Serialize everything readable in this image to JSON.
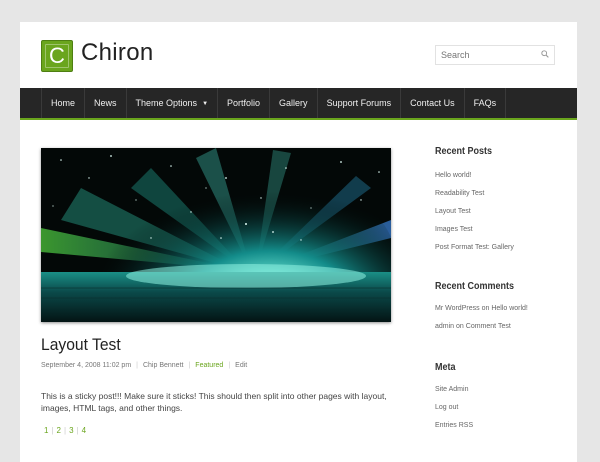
{
  "site": {
    "logo_letter": "C",
    "title": "Chiron",
    "accent_color": "#6aa51d"
  },
  "search": {
    "placeholder": "Search",
    "icon": "search-icon"
  },
  "nav": {
    "items": [
      {
        "label": "Home"
      },
      {
        "label": "News"
      },
      {
        "label": "Theme Options",
        "has_dropdown": true
      },
      {
        "label": "Portfolio"
      },
      {
        "label": "Gallery"
      },
      {
        "label": "Support Forums"
      },
      {
        "label": "Contact Us"
      },
      {
        "label": "FAQs"
      }
    ]
  },
  "post": {
    "image": "aurora-light-burst-over-water",
    "title": "Layout Test",
    "date": "September 4, 2008 11:02 pm",
    "author": "Chip Bennett",
    "category": "Featured",
    "edit_label": "Edit",
    "excerpt": "This is a sticky post!!! Make sure it sticks! This should then split into other pages with layout, images, HTML tags, and other things.",
    "pages": [
      "1",
      "2",
      "3",
      "4"
    ]
  },
  "sidebar": {
    "recent_posts": {
      "title": "Recent Posts",
      "items": [
        "Hello world!",
        "Readability Test",
        "Layout Test",
        "Images Test",
        "Post Format Test: Gallery"
      ]
    },
    "recent_comments": {
      "title": "Recent Comments",
      "items": [
        {
          "author": "Mr WordPress",
          "connector": "on",
          "post": "Hello world!"
        },
        {
          "author": "admin",
          "connector": "on",
          "post": "Comment Test"
        }
      ]
    },
    "meta": {
      "title": "Meta",
      "items": [
        "Site Admin",
        "Log out",
        "Entries RSS"
      ]
    }
  }
}
